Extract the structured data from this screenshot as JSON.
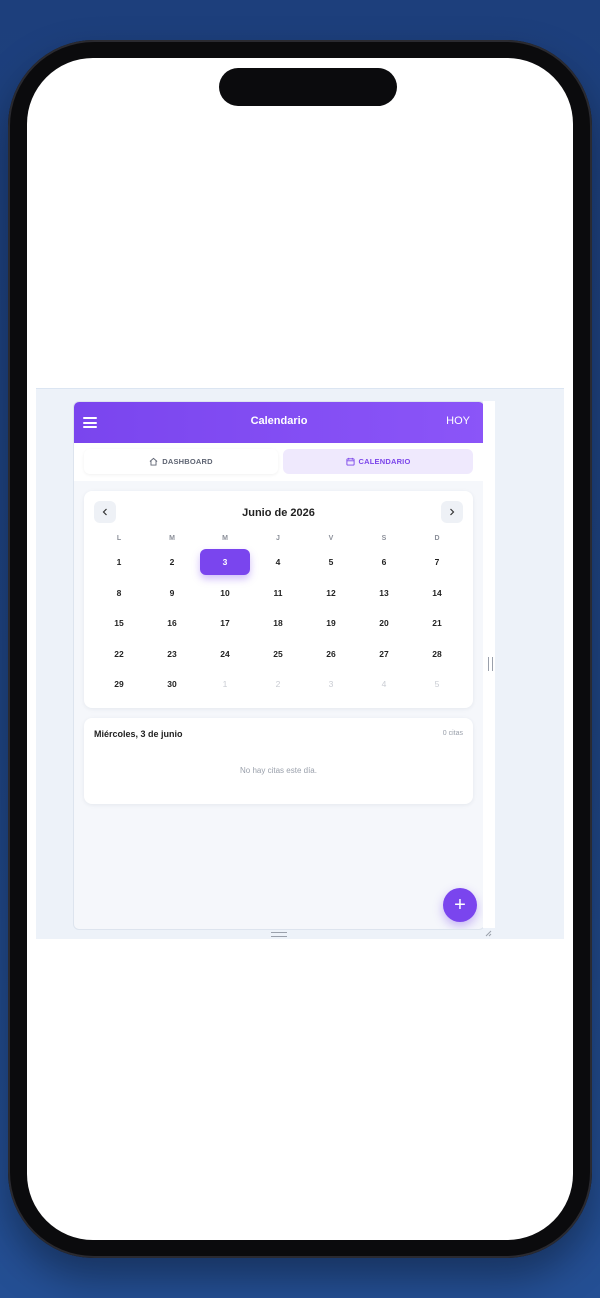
{
  "header": {
    "title": "Calendario",
    "today_label": "HOY",
    "menu_icon": "hamburger-icon"
  },
  "tabs": [
    {
      "label": "DASHBOARD",
      "icon": "home-icon",
      "active": false
    },
    {
      "label": "CALENDARIO",
      "icon": "calendar-icon",
      "active": true
    }
  ],
  "calendar": {
    "month_label": "Junio de 2026",
    "weekdays": [
      "L",
      "M",
      "M",
      "J",
      "V",
      "S",
      "D"
    ],
    "weeks": [
      [
        "1",
        "2",
        "3",
        "4",
        "5",
        "6",
        "7"
      ],
      [
        "8",
        "9",
        "10",
        "11",
        "12",
        "13",
        "14"
      ],
      [
        "15",
        "16",
        "17",
        "18",
        "19",
        "20",
        "21"
      ],
      [
        "22",
        "23",
        "24",
        "25",
        "26",
        "27",
        "28"
      ],
      [
        "29",
        "30",
        "1",
        "2",
        "3",
        "4",
        "5"
      ]
    ],
    "selected_day": "3",
    "prev_icon": "chevron-left-icon",
    "next_icon": "chevron-right-icon"
  },
  "events": {
    "date_label": "Miércoles, 3 de junio",
    "count_label": "0 citas",
    "empty_label": "No hay citas este día."
  },
  "fab": {
    "label": "+"
  },
  "colors": {
    "accent": "#7a45ee",
    "background": "#1f4584"
  }
}
